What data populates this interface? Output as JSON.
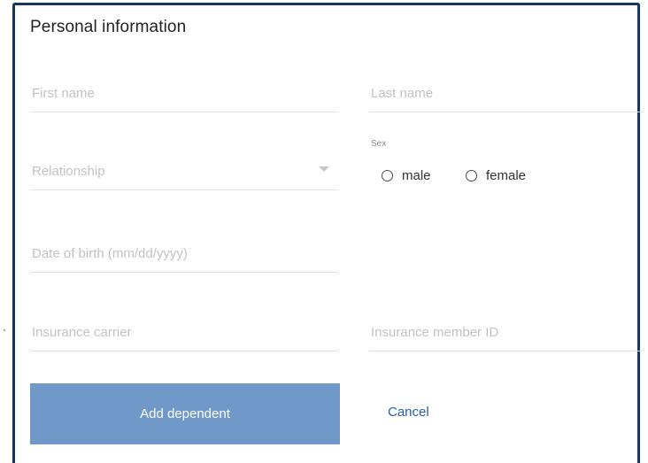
{
  "form": {
    "title": "Personal information",
    "first_name": {
      "placeholder": "First name",
      "value": ""
    },
    "last_name": {
      "placeholder": "Last name",
      "value": ""
    },
    "relationship": {
      "placeholder": "Relationship",
      "value": ""
    },
    "sex": {
      "label": "Sex",
      "options": [
        "male",
        "female"
      ],
      "selected": null
    },
    "dob": {
      "placeholder": "Date of birth (mm/dd/yyyy)",
      "value": ""
    },
    "insurance_carrier": {
      "placeholder": "Insurance carrier",
      "value": ""
    },
    "insurance_member_id": {
      "placeholder": "Insurance member ID",
      "value": ""
    }
  },
  "actions": {
    "add_label": "Add dependent",
    "cancel_label": "Cancel"
  },
  "colors": {
    "frame_border": "#16365e",
    "primary_button": "#7098c8",
    "link": "#2a5ea8",
    "placeholder": "#c2c2c2",
    "underline": "#e2e2e2"
  },
  "icons": {
    "relationship_dropdown": "chevron-down-icon",
    "sex_option": "radio-empty-icon"
  }
}
